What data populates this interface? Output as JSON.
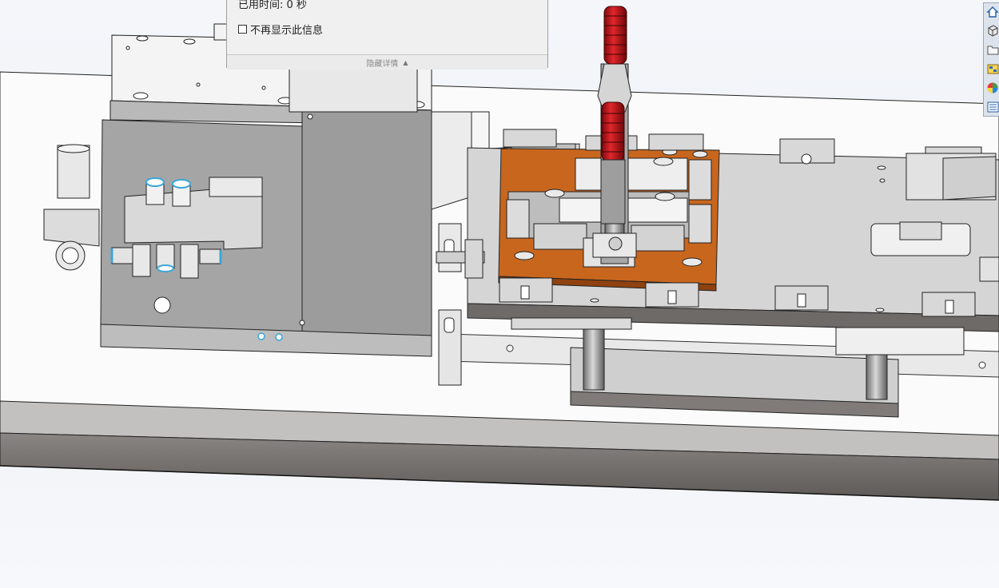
{
  "dialog": {
    "elapsed_text": "已用时间: 0 秒",
    "dont_show_label": "不再显示此信息",
    "hide_details_label": "隐藏详情"
  },
  "task_pane": {
    "buttons": [
      "home-icon",
      "parts-library-icon",
      "file-explorer-icon",
      "view-palette-icon",
      "appearances-icon",
      "custom-properties-icon"
    ]
  },
  "colors": {
    "background": "#f2f4f8",
    "fixture_orange": "#c8661e",
    "clamp_red": "#c8131a",
    "steel_dark": "#6e6a68",
    "steel_light": "#d6d6d6",
    "fitting_blue": "#3aa7d8"
  }
}
